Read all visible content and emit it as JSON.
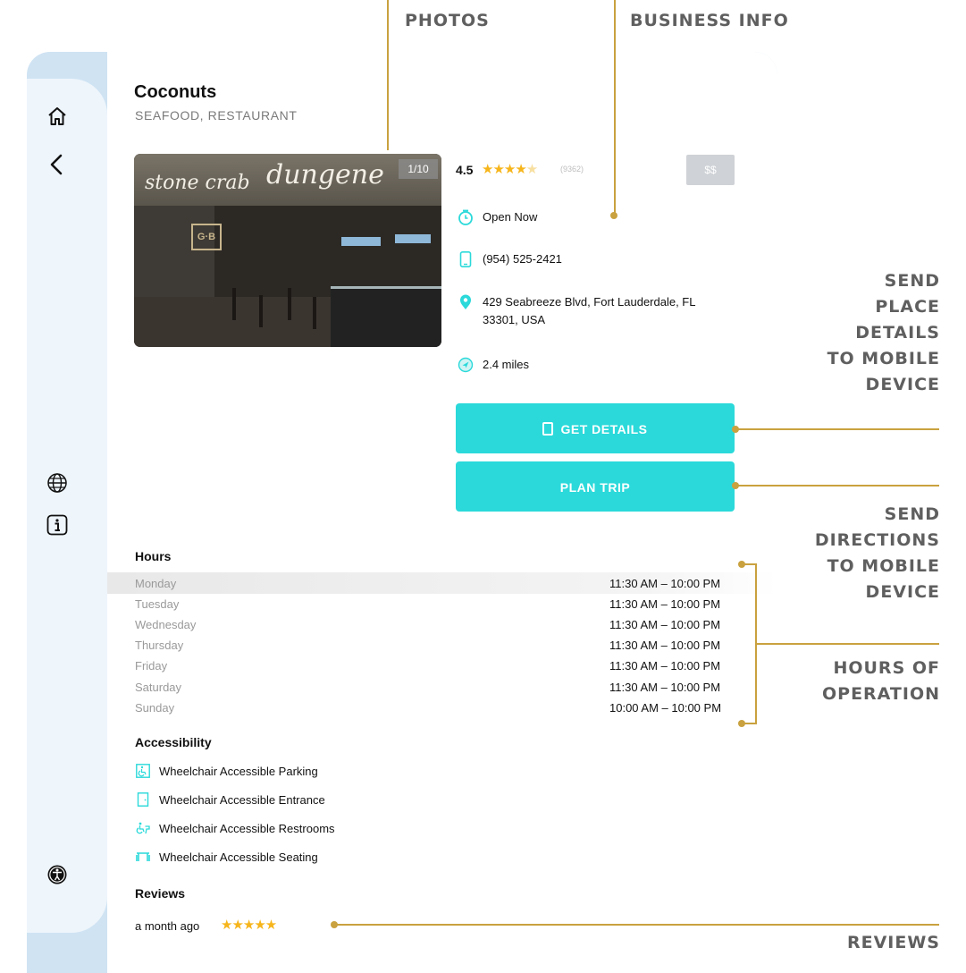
{
  "callouts": {
    "photos": "PHOTOS",
    "business_info": "BUSINESS INFO",
    "send_place_lines": [
      "SEND",
      "PLACE",
      "DETAILS",
      "TO MOBILE",
      "DEVICE"
    ],
    "send_directions_lines": [
      "SEND",
      "DIRECTIONS",
      "TO MOBILE",
      "DEVICE"
    ],
    "hours_lines": [
      "HOURS OF",
      "OPERATION"
    ],
    "reviews": "REVIEWS"
  },
  "sidebar": {
    "icons": [
      "home-icon",
      "back-chevron-icon",
      "globe-icon",
      "info-icon",
      "accessibility-icon"
    ]
  },
  "place": {
    "name": "Coconuts",
    "category": "SEAFOOD, RESTAURANT",
    "photo": {
      "counter": "1/10",
      "sign_left": "stone crab",
      "sign_right": "dungene",
      "logo": "G·B"
    },
    "rating": "4.5",
    "rating_stars": 4.5,
    "review_count": "(9362)",
    "price": "$$",
    "status": "Open Now",
    "phone": "(954) 525-2421",
    "address_line1": "429 Seabreeze Blvd, Fort Lauderdale, FL",
    "address_line2": "33301, USA",
    "distance": "2.4 miles"
  },
  "buttons": {
    "get_details": "GET DETAILS",
    "plan_trip": "PLAN TRIP"
  },
  "hours": {
    "heading": "Hours",
    "rows": [
      {
        "day": "Monday",
        "time": "11:30 AM – 10:00 PM"
      },
      {
        "day": "Tuesday",
        "time": "11:30 AM – 10:00 PM"
      },
      {
        "day": "Wednesday",
        "time": "11:30 AM – 10:00 PM"
      },
      {
        "day": "Thursday",
        "time": "11:30 AM – 10:00 PM"
      },
      {
        "day": "Friday",
        "time": "11:30 AM – 10:00 PM"
      },
      {
        "day": "Saturday",
        "time": "11:30 AM – 10:00 PM"
      },
      {
        "day": "Sunday",
        "time": "10:00 AM – 10:00 PM"
      }
    ]
  },
  "accessibility": {
    "heading": "Accessibility",
    "items": [
      "Wheelchair Accessible Parking",
      "Wheelchair Accessible Entrance",
      "Wheelchair Accessible Restrooms",
      "Wheelchair Accessible Seating"
    ]
  },
  "reviews": {
    "heading": "Reviews",
    "first_when": "a month ago",
    "first_stars": 5
  },
  "colors": {
    "accent_teal": "#2bd9da",
    "callout_gold": "#c9a13f",
    "star_gold": "#f6b51b",
    "frame_blue": "#cfe3f3"
  }
}
